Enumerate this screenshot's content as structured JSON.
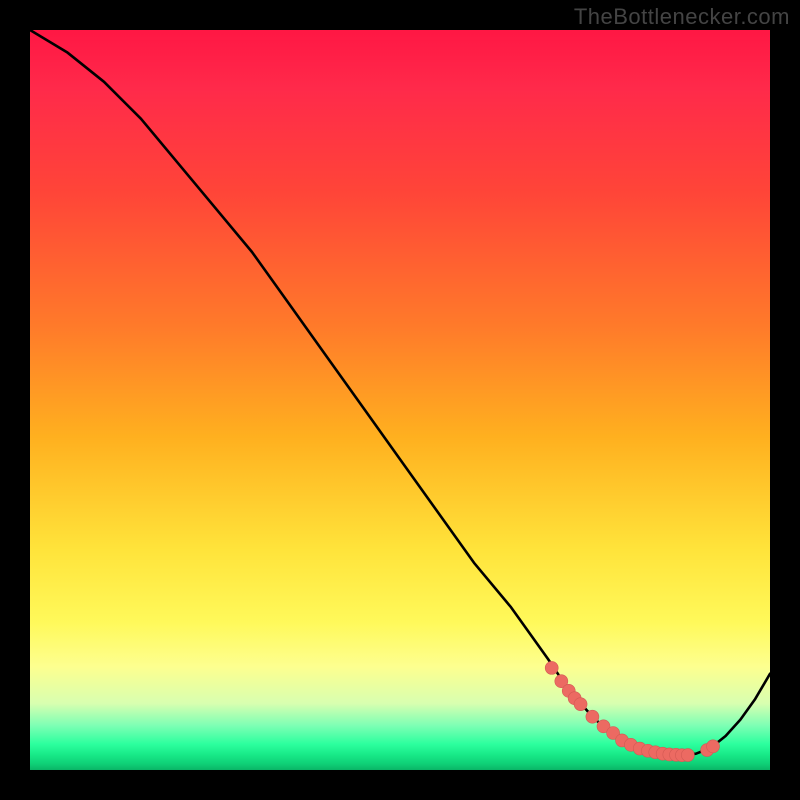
{
  "watermark": "TheBottlenecker.com",
  "chart_data": {
    "type": "line",
    "title": "",
    "xlabel": "",
    "ylabel": "",
    "xlim": [
      0,
      100
    ],
    "ylim": [
      0,
      100
    ],
    "series": [
      {
        "name": "bottleneck-curve",
        "x": [
          0,
          5,
          10,
          15,
          20,
          25,
          30,
          35,
          40,
          45,
          50,
          55,
          60,
          65,
          70,
          72,
          74,
          76,
          78,
          80,
          82,
          84,
          86,
          88,
          90,
          92,
          94,
          96,
          98,
          100
        ],
        "y": [
          100,
          97,
          93,
          88,
          82,
          76,
          70,
          63,
          56,
          49,
          42,
          35,
          28,
          22,
          15,
          12,
          9.5,
          7.2,
          5.4,
          4.0,
          3.0,
          2.4,
          2.1,
          2.0,
          2.2,
          3.0,
          4.6,
          6.8,
          9.6,
          13
        ]
      }
    ],
    "markers": {
      "name": "highlight-points",
      "x": [
        70.5,
        71.8,
        72.8,
        73.6,
        74.4,
        76.0,
        77.5,
        78.8,
        80.0,
        81.2,
        82.4,
        83.5,
        84.5,
        85.5,
        86.4,
        87.3,
        88.1,
        88.9,
        91.5,
        92.3
      ],
      "y": [
        13.8,
        12.0,
        10.7,
        9.7,
        8.9,
        7.2,
        5.9,
        5.0,
        4.0,
        3.4,
        2.9,
        2.6,
        2.4,
        2.2,
        2.1,
        2.05,
        2.0,
        2.02,
        2.7,
        3.2
      ]
    }
  }
}
